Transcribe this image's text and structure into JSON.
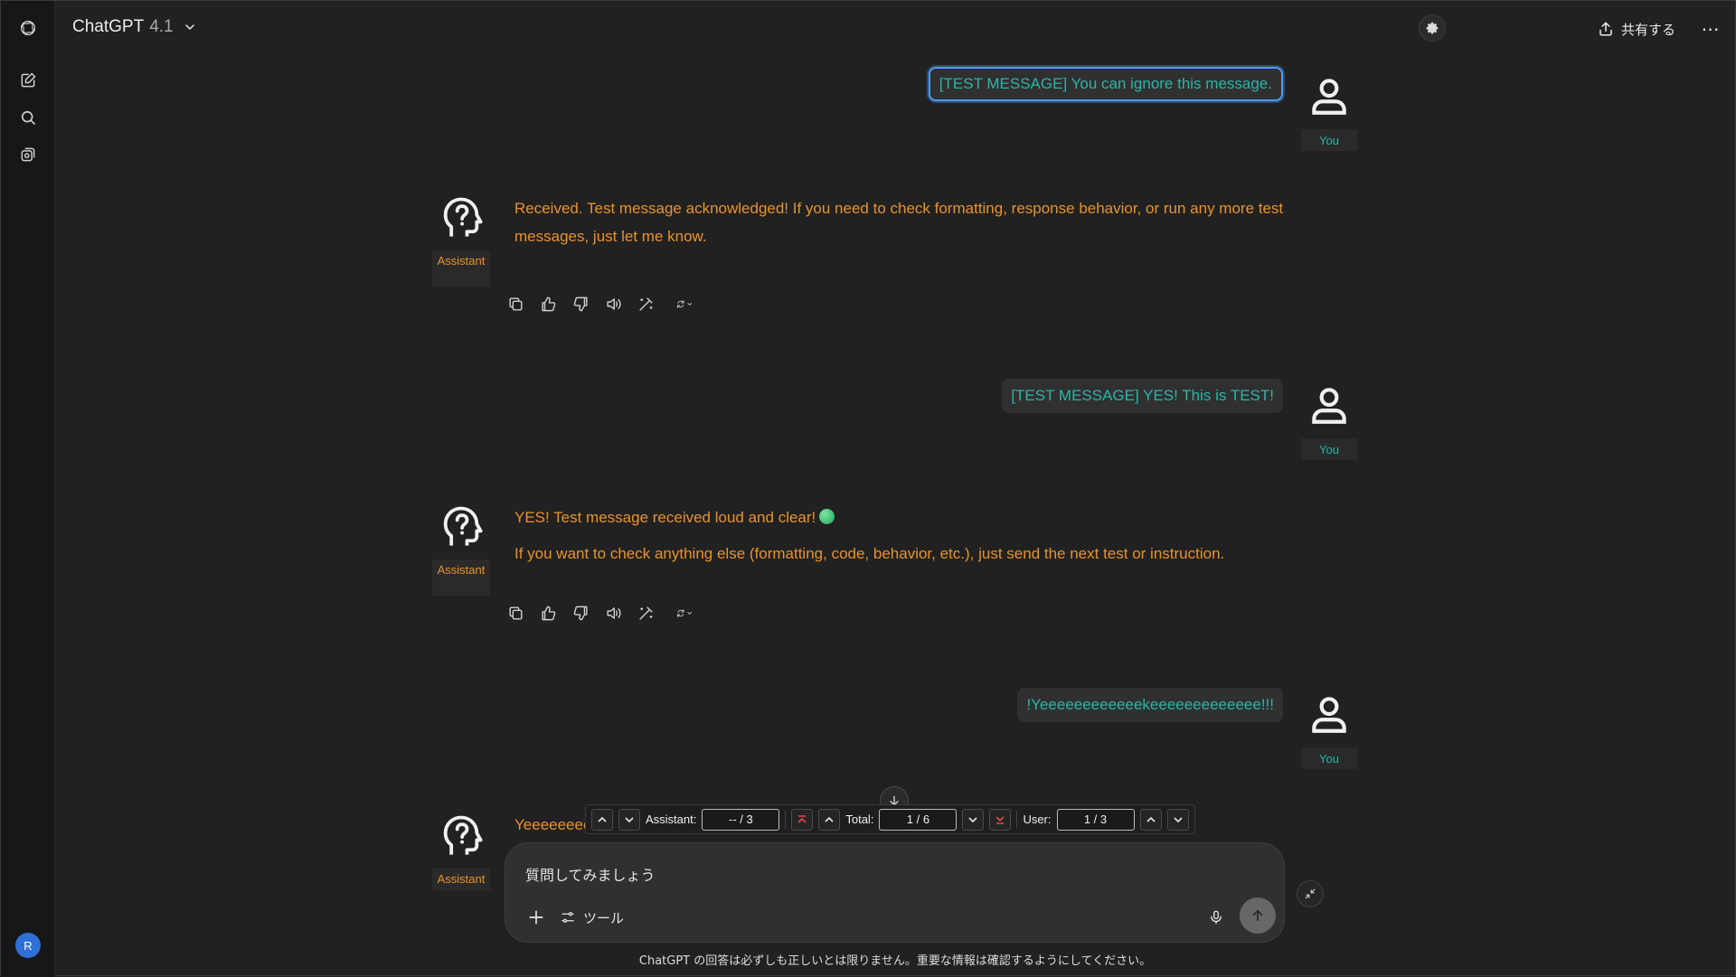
{
  "header": {
    "model_name": "ChatGPT",
    "model_version": "4.1",
    "share_label": "共有する"
  },
  "sidebar": {
    "user_initial": "R"
  },
  "messages": [
    {
      "role": "user",
      "text": "[TEST MESSAGE] You can ignore this message.",
      "label": "You"
    },
    {
      "role": "assistant",
      "label": "Assistant",
      "paragraphs": [
        "Received. Test message acknowledged! If you need to check formatting, response behavior, or run any more test messages, just let me know."
      ]
    },
    {
      "role": "user",
      "text": "[TEST MESSAGE] YES! This is TEST!",
      "label": "You"
    },
    {
      "role": "assistant",
      "label": "Assistant",
      "paragraphs": [
        "YES! Test message received loud and clear!",
        "If you want to check anything else (formatting, code, behavior, etc.), just send the next test or instruction."
      ]
    },
    {
      "role": "user",
      "text": "!Yeeeeeeeeeeeekeeeeeeeeeeeee!!!",
      "label": "You"
    },
    {
      "role": "assistant",
      "label": "Assistant",
      "partial_text": "Yeeeeeeee"
    }
  ],
  "navigator": {
    "assistant_label": "Assistant:",
    "assistant_value": "-- / 3",
    "total_label": "Total:",
    "total_value": "1 / 6",
    "user_label": "User:",
    "user_value": "1 / 3"
  },
  "composer": {
    "placeholder": "質問してみましょう",
    "tools_label": "ツール"
  },
  "footer": {
    "disclaimer": "ChatGPT の回答は必ずしも正しいとは限りません。重要な情報は確認するようにしてください。"
  },
  "colors": {
    "user_text": "#2bb5a6",
    "assistant_text": "#e8922f",
    "focus_ring": "#4d9bf5",
    "background": "#212121"
  }
}
